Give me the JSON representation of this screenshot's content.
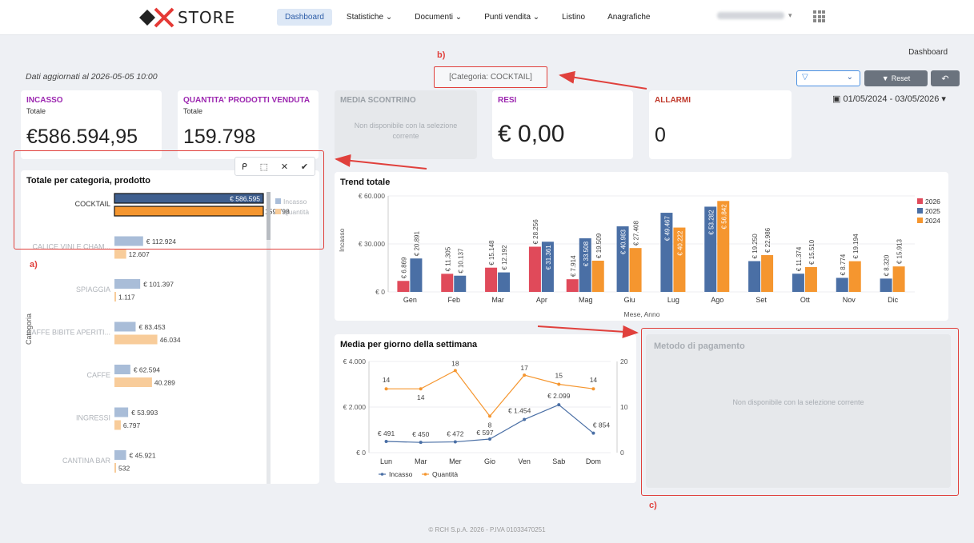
{
  "brand": {
    "name": "STORE"
  },
  "nav": {
    "items": [
      "Dashboard",
      "Statistiche ⌄",
      "Documenti ⌄",
      "Punti vendita ⌄",
      "Listino",
      "Anagrafiche"
    ],
    "active": 0
  },
  "breadcrumb": "Dashboard",
  "updated_text": "Dati aggiornati al 2026-05-05 10:00",
  "category_filter": "[Categoria: COCKTAIL]",
  "filter_select": {
    "icon": "filter-icon",
    "value": ""
  },
  "reset_label": "Reset",
  "date_range": "01/05/2024 - 03/05/2026",
  "kpis": [
    {
      "title": "INCASSO",
      "subtitle": "Totale",
      "value": "€586.594,95",
      "color": "#9c27b0"
    },
    {
      "title": "QUANTITA' PRODOTTI VENDUTA",
      "subtitle": "Totale",
      "value": "159.798",
      "color": "#9c27b0"
    },
    {
      "title": "MEDIA SCONTRINO",
      "subtitle": "",
      "value": "",
      "na": "Non disponibile con la selezione corrente"
    },
    {
      "title": "RESI",
      "subtitle": "",
      "value": "€ 0,00",
      "color": "#9c27b0"
    },
    {
      "title": "ALLARMI",
      "subtitle": "",
      "value": "0",
      "color": "#c0392b"
    }
  ],
  "annotations": {
    "a": "a)",
    "b": "b)",
    "c": "c)"
  },
  "category_panel": {
    "title": "Totale per categoria, prodotto",
    "yaxis_label": "Categoria",
    "legend": [
      "Incasso",
      "Quantità"
    ],
    "toolbar_icons": [
      "lasso-icon",
      "selection-icon",
      "cancel-icon",
      "confirm-icon"
    ],
    "chart_data": {
      "type": "bar",
      "orientation": "horizontal",
      "categories": [
        "COCKTAIL",
        "CALICE VINI E CHAM...",
        "SPIAGGIA",
        "CAFFE BIBITE APERITI...",
        "CAFFE",
        "INGRESSI",
        "CANTINA BAR"
      ],
      "series": [
        {
          "name": "Incasso",
          "values": [
            586595,
            112924,
            101397,
            83453,
            62594,
            53993,
            45921
          ],
          "labels": [
            "€ 586.595",
            "€ 112.924",
            "€ 101.397",
            "€ 83.453",
            "€ 62.594",
            "€ 53.993",
            "€ 45.921"
          ]
        },
        {
          "name": "Quantità",
          "values": [
            159798,
            12607,
            1117,
            46034,
            40289,
            6797,
            532
          ],
          "labels": [
            "159.798",
            "12.607",
            "1.117",
            "46.034",
            "40.289",
            "6.797",
            "532"
          ]
        }
      ]
    }
  },
  "trend_panel": {
    "title": "Trend totale",
    "chart_data": {
      "type": "bar",
      "categories": [
        "Gen",
        "Feb",
        "Mar",
        "Apr",
        "Mag",
        "Giu",
        "Lug",
        "Ago",
        "Set",
        "Ott",
        "Nov",
        "Dic"
      ],
      "series": [
        {
          "name": "2026",
          "color": "#e04a5a",
          "values": [
            6869,
            11305,
            15148,
            28256,
            7914,
            null,
            null,
            null,
            null,
            null,
            null,
            null
          ]
        },
        {
          "name": "2025",
          "color": "#4a6fa5",
          "values": [
            20891,
            10137,
            12192,
            31361,
            33508,
            40983,
            49467,
            53282,
            19250,
            11374,
            8774,
            8320
          ]
        },
        {
          "name": "2024",
          "color": "#f5962f",
          "values": [
            null,
            null,
            null,
            null,
            19509,
            27408,
            40222,
            56842,
            22986,
            15510,
            19194,
            15913
          ]
        }
      ],
      "ylabel": "Incasso",
      "xlabel": "Mese, Anno",
      "yticks": [
        "€ 0",
        "€ 30.000",
        "€ 60.000"
      ],
      "ylim": [
        0,
        60000
      ],
      "legend_position": "right"
    }
  },
  "weekday_panel": {
    "title": "Media per giorno della settimana",
    "chart_data": {
      "type": "line",
      "categories": [
        "Lun",
        "Mar",
        "Mer",
        "Gio",
        "Ven",
        "Sab",
        "Dom"
      ],
      "series": [
        {
          "name": "Incasso",
          "color": "#4a6fa5",
          "values": [
            491,
            450,
            472,
            597,
            1454,
            2099,
            854
          ],
          "labels": [
            "€ 491",
            "€ 450",
            "€ 472",
            "€ 597",
            "€ 1.454",
            "€ 2.099",
            "€ 854"
          ],
          "axis": "left"
        },
        {
          "name": "Quantità",
          "color": "#f5962f",
          "values": [
            14,
            14,
            18,
            8,
            17,
            15,
            14
          ],
          "labels": [
            "14",
            "14",
            "18",
            "8",
            "17",
            "15",
            "14"
          ],
          "axis": "right"
        }
      ],
      "yticks_left": [
        "€ 0",
        "€ 2.000",
        "€ 4.000"
      ],
      "yticks_right": [
        "0",
        "10",
        "20"
      ],
      "ylim_left": [
        0,
        4000
      ],
      "ylim_right": [
        0,
        20
      ],
      "legend_position": "bottom"
    }
  },
  "payment_panel": {
    "title": "Metodo di pagamento",
    "message": "Non disponibile con la selezione corrente"
  },
  "footer": "© RCH S.p.A. 2026 - P.IVA 01033470251"
}
